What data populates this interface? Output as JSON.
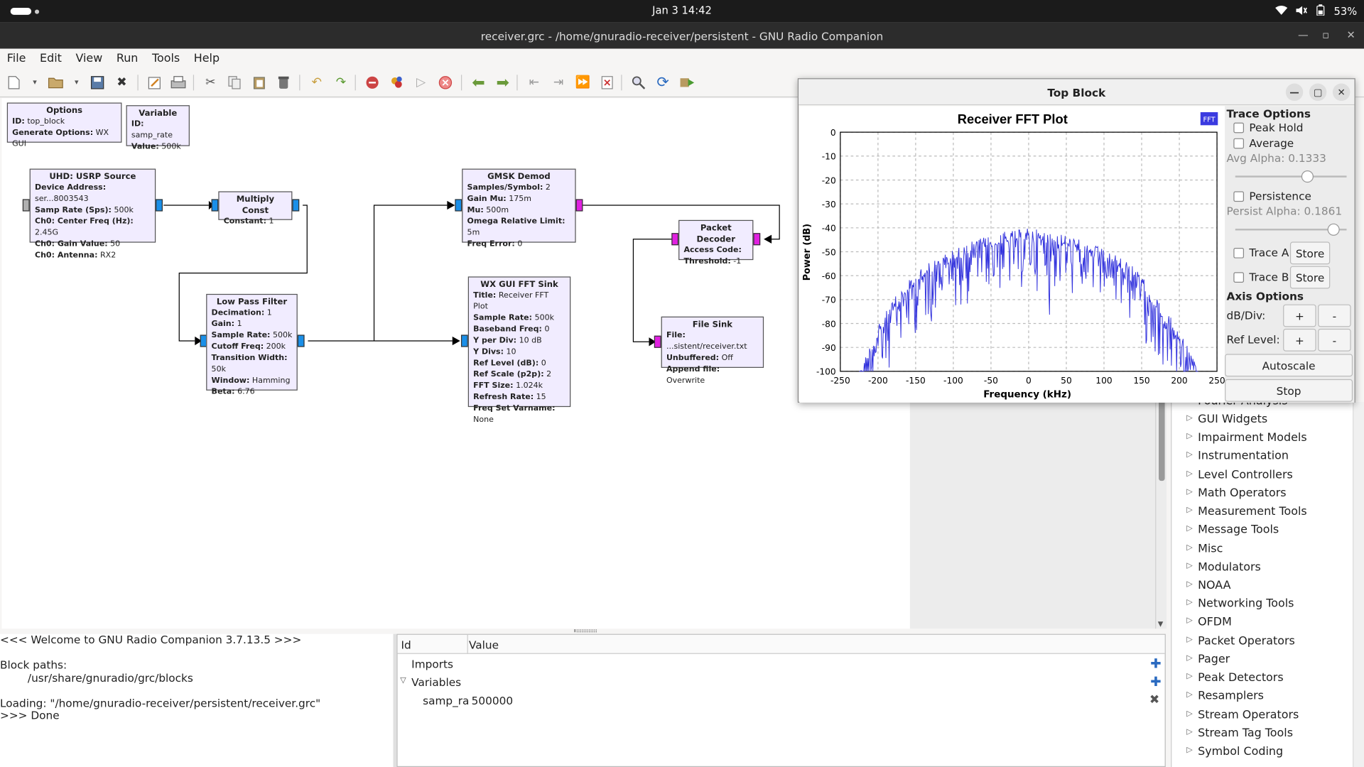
{
  "system": {
    "clock": "Jan 3  14:42",
    "battery": "53%"
  },
  "window": {
    "title": "receiver.grc - /home/gnuradio-receiver/persistent - GNU Radio Companion"
  },
  "menu": [
    "File",
    "Edit",
    "View",
    "Run",
    "Tools",
    "Help"
  ],
  "toolbar_icons": [
    "new-icon",
    "open-icon",
    "save-icon",
    "close-icon",
    "properties-icon",
    "print-icon",
    "cut-icon",
    "copy-icon",
    "paste-icon",
    "delete-icon",
    "undo-icon",
    "redo-icon",
    "disable-icon",
    "bypass-icon",
    "run-icon",
    "stop-icon",
    "rotate-left-icon",
    "rotate-right-icon",
    "move-up-icon",
    "move-down-icon",
    "find-icon",
    "reload-icon",
    "execute-icon"
  ],
  "blocks": {
    "options": {
      "title": "Options",
      "rows": [
        [
          "ID:",
          "top_block"
        ],
        [
          "Generate Options:",
          "WX GUI"
        ]
      ]
    },
    "variable": {
      "title": "Variable",
      "rows": [
        [
          "ID:",
          "samp_rate"
        ],
        [
          "Value:",
          "500k"
        ]
      ]
    },
    "usrp": {
      "title": "UHD: USRP Source",
      "rows": [
        [
          "Device Address:",
          "ser...8003543"
        ],
        [
          "Samp Rate (Sps):",
          "500k"
        ],
        [
          "Ch0: Center Freq (Hz):",
          "2.45G"
        ],
        [
          "Ch0: Gain Value:",
          "50"
        ],
        [
          "Ch0: Antenna:",
          "RX2"
        ]
      ]
    },
    "mult": {
      "title": "Multiply Const",
      "rows": [
        [
          "Constant:",
          "1"
        ]
      ]
    },
    "lpf": {
      "title": "Low Pass Filter",
      "rows": [
        [
          "Decimation:",
          "1"
        ],
        [
          "Gain:",
          "1"
        ],
        [
          "Sample Rate:",
          "500k"
        ],
        [
          "Cutoff Freq:",
          "200k"
        ],
        [
          "Transition Width:",
          "50k"
        ],
        [
          "Window:",
          "Hamming"
        ],
        [
          "Beta:",
          "6.76"
        ]
      ]
    },
    "gmsk": {
      "title": "GMSK Demod",
      "rows": [
        [
          "Samples/Symbol:",
          "2"
        ],
        [
          "Gain Mu:",
          "175m"
        ],
        [
          "Mu:",
          "500m"
        ],
        [
          "Omega Relative Limit:",
          "5m"
        ],
        [
          "Freq Error:",
          "0"
        ]
      ]
    },
    "fftsink": {
      "title": "WX GUI FFT Sink",
      "rows": [
        [
          "Title:",
          "Receiver FFT Plot"
        ],
        [
          "Sample Rate:",
          "500k"
        ],
        [
          "Baseband Freq:",
          "0"
        ],
        [
          "Y per Div:",
          "10 dB"
        ],
        [
          "Y Divs:",
          "10"
        ],
        [
          "Ref Level (dB):",
          "0"
        ],
        [
          "Ref Scale (p2p):",
          "2"
        ],
        [
          "FFT Size:",
          "1.024k"
        ],
        [
          "Refresh Rate:",
          "15"
        ],
        [
          "Freq Set Varname:",
          "None"
        ]
      ]
    },
    "pktdec": {
      "title": "Packet Decoder",
      "rows": [
        [
          "Access Code:",
          ""
        ],
        [
          "Threshold:",
          "-1"
        ]
      ]
    },
    "filesink": {
      "title": "File Sink",
      "rows": [
        [
          "File:",
          "...sistent/receiver.txt"
        ],
        [
          "Unbuffered:",
          "Off"
        ],
        [
          "Append file:",
          "Overwrite"
        ]
      ]
    }
  },
  "console": [
    "<<< Welcome to GNU Radio Companion 3.7.13.5 >>>",
    "",
    "Block paths:",
    "        /usr/share/gnuradio/grc/blocks",
    "",
    "Loading: \"/home/gnuradio-receiver/persistent/receiver.grc\"",
    ">>> Done"
  ],
  "variables": {
    "col_id": "Id",
    "col_value": "Value",
    "imports": "Imports",
    "variables": "Variables",
    "row_id": "samp_ra",
    "row_value": "500000"
  },
  "library": [
    "Fourier Analysis",
    "GUI Widgets",
    "Impairment Models",
    "Instrumentation",
    "Level Controllers",
    "Math Operators",
    "Measurement Tools",
    "Message Tools",
    "Misc",
    "Modulators",
    "NOAA",
    "Networking Tools",
    "OFDM",
    "Packet Operators",
    "Pager",
    "Peak Detectors",
    "Resamplers",
    "Stream Operators",
    "Stream Tag Tools",
    "Symbol Coding"
  ],
  "fft_window": {
    "title": "Top Block",
    "badge": "FFT",
    "trace_options": "Trace Options",
    "peak_hold": "Peak Hold",
    "average": "Average",
    "avg_alpha": "Avg Alpha: 0.1333",
    "persistence": "Persistence",
    "persist_alpha": "Persist Alpha: 0.1861",
    "trace_a": "Trace A",
    "trace_b": "Trace B",
    "store": "Store",
    "axis_options": "Axis Options",
    "db_div": "dB/Div:",
    "ref_level": "Ref Level:",
    "plus": "+",
    "minus": "-",
    "autoscale": "Autoscale",
    "stop": "Stop",
    "avg_alpha_value": 0.1333,
    "persist_alpha_value": 0.1861
  },
  "chart_data": {
    "type": "line",
    "title": "Receiver FFT Plot",
    "xlabel": "Frequency (kHz)",
    "ylabel": "Power (dB)",
    "xlim": [
      -250,
      250
    ],
    "ylim": [
      -100,
      0
    ],
    "xticks": [
      -250,
      -200,
      -150,
      -100,
      -50,
      0,
      50,
      100,
      150,
      200,
      250
    ],
    "yticks": [
      0,
      -10,
      -20,
      -30,
      -40,
      -50,
      -60,
      -70,
      -80,
      -90,
      -100
    ],
    "grid": true,
    "color": "#3333dd",
    "envelope": [
      [
        -225,
        -100
      ],
      [
        -210,
        -88
      ],
      [
        -195,
        -78
      ],
      [
        -180,
        -70
      ],
      [
        -165,
        -64
      ],
      [
        -150,
        -59
      ],
      [
        -135,
        -55
      ],
      [
        -120,
        -52
      ],
      [
        -100,
        -49
      ],
      [
        -80,
        -46
      ],
      [
        -60,
        -44
      ],
      [
        -40,
        -42
      ],
      [
        -20,
        -41
      ],
      [
        0,
        -40
      ],
      [
        20,
        -41
      ],
      [
        40,
        -42
      ],
      [
        60,
        -44
      ],
      [
        80,
        -46
      ],
      [
        100,
        -49
      ],
      [
        120,
        -52
      ],
      [
        135,
        -55
      ],
      [
        150,
        -60
      ],
      [
        165,
        -67
      ],
      [
        180,
        -74
      ],
      [
        195,
        -80
      ],
      [
        210,
        -88
      ],
      [
        225,
        -100
      ]
    ]
  }
}
